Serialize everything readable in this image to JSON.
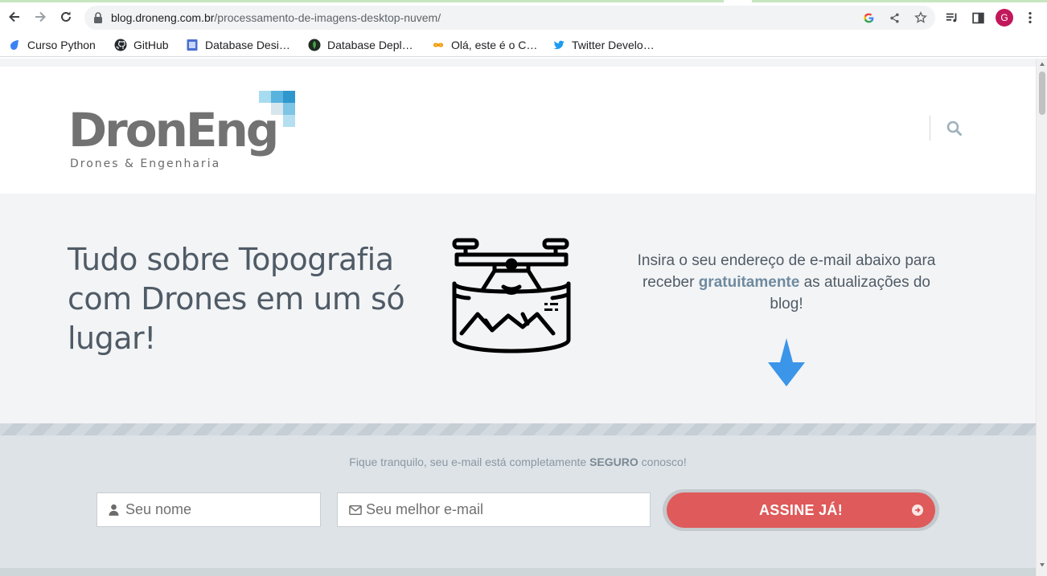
{
  "browser": {
    "url_host": "blog.droneng.com.br",
    "url_path": "/processamento-de-imagens-desktop-nuvem/",
    "profile_initial": "G",
    "bookmarks": [
      {
        "label": "Curso Python",
        "icon": "droplet-icon"
      },
      {
        "label": "GitHub",
        "icon": "github-icon"
      },
      {
        "label": "Database Desi…",
        "icon": "document-icon"
      },
      {
        "label": "Database Depl…",
        "icon": "leaf-icon"
      },
      {
        "label": "Olá, este é o C…",
        "icon": "infinity-icon"
      },
      {
        "label": "Twitter Develo…",
        "icon": "twitter-icon"
      }
    ]
  },
  "site": {
    "logo_text": "DronEng",
    "logo_subtitle": "Drones & Engenharia",
    "colors": {
      "logo_gray": "#727272",
      "accent_blue": "#3b95e8",
      "button_red": "#df5a5a"
    }
  },
  "hero": {
    "title_lines": [
      "Tudo sobre Topografia",
      "com Drones em um só",
      "lugar!"
    ],
    "text_before": "Insira o seu endereço de e-mail abaixo para receber ",
    "text_bold": "gratuitamente",
    "text_after": " as atualizações do blog!"
  },
  "form": {
    "note_before": "Fique tranquilo, seu e-mail está completamente ",
    "note_bold": "SEGURO",
    "note_after": " conosco!",
    "name_placeholder": "Seu nome",
    "email_placeholder": "Seu melhor e-mail",
    "submit_label": "ASSINE JÁ!"
  }
}
